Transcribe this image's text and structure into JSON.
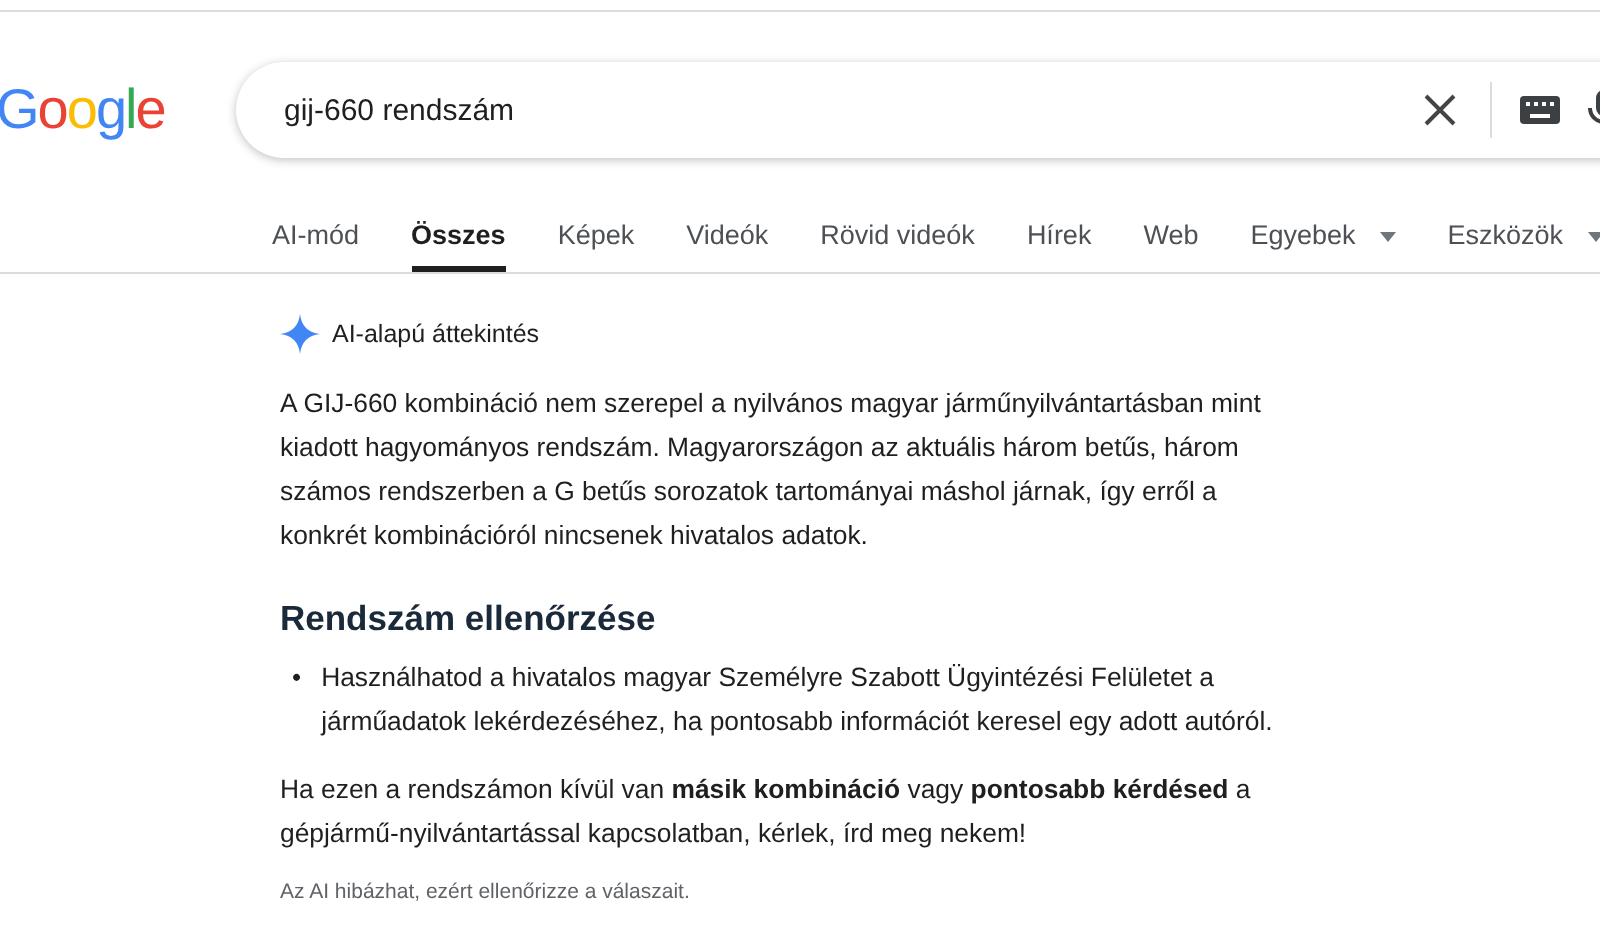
{
  "logo": "Google",
  "search": {
    "value": "gij-660 rendszám"
  },
  "tabs": [
    {
      "label": "AI-mód",
      "selected": false,
      "has_menu": false
    },
    {
      "label": "Összes",
      "selected": true,
      "has_menu": false
    },
    {
      "label": "Képek",
      "selected": false,
      "has_menu": false
    },
    {
      "label": "Videók",
      "selected": false,
      "has_menu": false
    },
    {
      "label": "Rövid videók",
      "selected": false,
      "has_menu": false
    },
    {
      "label": "Hírek",
      "selected": false,
      "has_menu": false
    },
    {
      "label": "Web",
      "selected": false,
      "has_menu": false
    },
    {
      "label": "Egyebek",
      "selected": false,
      "has_menu": true
    },
    {
      "label": "Eszközök",
      "selected": false,
      "has_menu": true
    }
  ],
  "overview": {
    "title": "AI-alapú áttekintés",
    "paragraph": "A GIJ-660 kombináció nem szerepel a nyilvános magyar járműnyilvántartásban mint kiadott hagyományos rendszám. Magyarországon az aktuális három betűs, három számos rendszerben a G betűs sorozatok tartományai máshol járnak, így erről a konkrét kombinációról nincsenek hivatalos adatok.",
    "heading": "Rendszám ellenőrzése",
    "bullets": [
      {
        "marker": "•",
        "text": "Használhatod a hivatalos magyar Személyre Szabott Ügyintézési Felületet a járműadatok lekérdezéséhez, ha pontosabb információt keresel egy adott autóról."
      }
    ],
    "closing": "Ha ezen a rendszámon kívül van **másik kombináció** vagy **pontosabb kérdésed** a gépjármű-nyilvántartással kapcsolatban, kérlek, írd meg nekem!",
    "disclaimer": "Az AI hibázhat, ezért ellenőrizze a válaszait."
  }
}
